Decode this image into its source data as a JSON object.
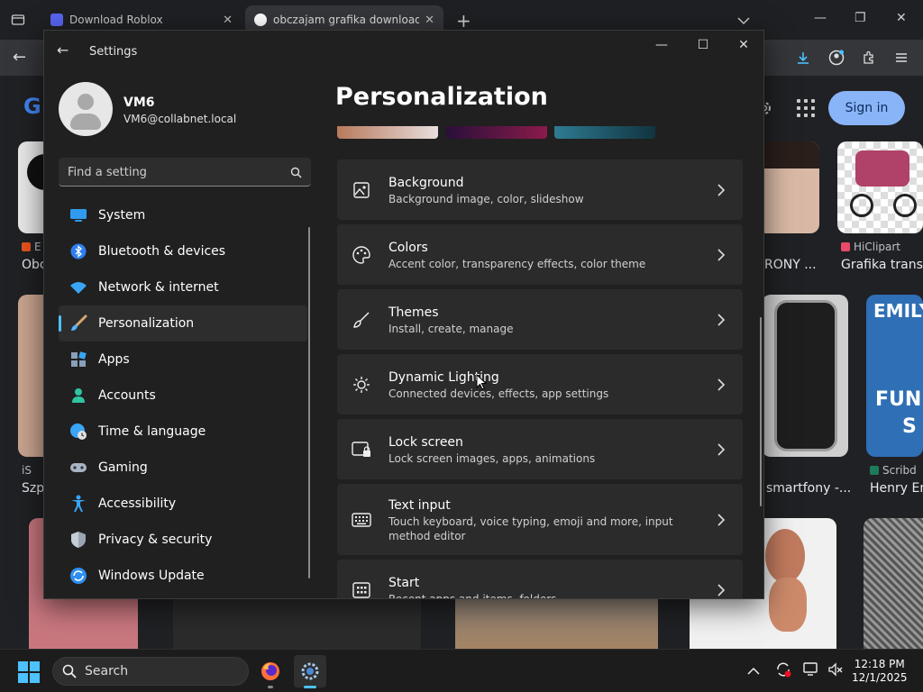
{
  "browser": {
    "tabs": [
      {
        "title": "Download Roblox",
        "active": false
      },
      {
        "title": "obczajam grafika download - G",
        "active": true
      }
    ],
    "signin_label": "Sign in",
    "results": {
      "row1": [
        {
          "source": "E",
          "caption": "Obc"
        },
        {
          "source": "",
          "caption": "RONY ..."
        },
        {
          "source": "HiClipart",
          "caption": "Grafika transp"
        }
      ],
      "row2": [
        {
          "source": "iS",
          "caption": "Szp"
        },
        {
          "source": "",
          "caption": "smartfony -..."
        },
        {
          "source": "Scribd",
          "caption": "Henry En"
        }
      ],
      "emily_text": "EMILY",
      "fun_text": "FUN",
      "s_text": "S"
    }
  },
  "settings": {
    "title": "Settings",
    "profile": {
      "name": "VM6",
      "email": "VM6@collabnet.local"
    },
    "search": {
      "placeholder": "Find a setting"
    },
    "nav": [
      {
        "label": "System",
        "icon": "monitor-icon",
        "active": false
      },
      {
        "label": "Bluetooth & devices",
        "icon": "bluetooth-icon",
        "active": false
      },
      {
        "label": "Network & internet",
        "icon": "wifi-icon",
        "active": false
      },
      {
        "label": "Personalization",
        "icon": "brush-icon",
        "active": true
      },
      {
        "label": "Apps",
        "icon": "apps-icon",
        "active": false
      },
      {
        "label": "Accounts",
        "icon": "person-icon",
        "active": false
      },
      {
        "label": "Time & language",
        "icon": "globe-clock-icon",
        "active": false
      },
      {
        "label": "Gaming",
        "icon": "gamepad-icon",
        "active": false
      },
      {
        "label": "Accessibility",
        "icon": "accessibility-icon",
        "active": false
      },
      {
        "label": "Privacy & security",
        "icon": "shield-icon",
        "active": false
      },
      {
        "label": "Windows Update",
        "icon": "update-icon",
        "active": false
      }
    ],
    "page_title": "Personalization",
    "cards": [
      {
        "title": "Background",
        "subtitle": "Background image, color, slideshow",
        "icon": "image-icon"
      },
      {
        "title": "Colors",
        "subtitle": "Accent color, transparency effects, color theme",
        "icon": "palette-icon"
      },
      {
        "title": "Themes",
        "subtitle": "Install, create, manage",
        "icon": "brush-icon"
      },
      {
        "title": "Dynamic Lighting",
        "subtitle": "Connected devices, effects, app settings",
        "icon": "sun-icon"
      },
      {
        "title": "Lock screen",
        "subtitle": "Lock screen images, apps, animations",
        "icon": "lock-screen-icon"
      },
      {
        "title": "Text input",
        "subtitle": "Touch keyboard, voice typing, emoji and more, input method editor",
        "icon": "keyboard-icon"
      },
      {
        "title": "Start",
        "subtitle": "Recent apps and items, folders",
        "icon": "start-icon"
      }
    ]
  },
  "taskbar": {
    "search_label": "Search",
    "time": "12:18 PM",
    "date": "12/1/2025"
  },
  "colors": {
    "accent": "#4cc2ff",
    "window_bg": "#202020",
    "card_bg": "#2b2b2b",
    "signin_bg": "#8ab4f8"
  }
}
